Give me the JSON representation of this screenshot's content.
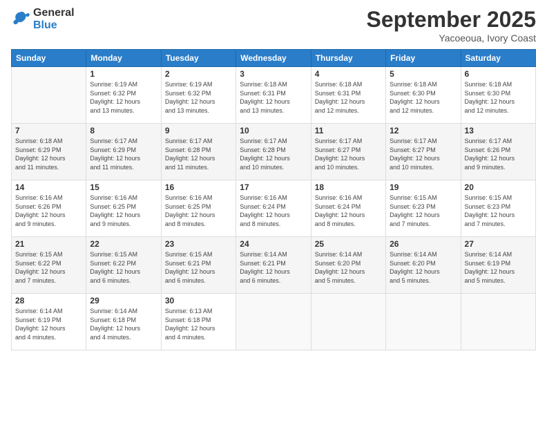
{
  "header": {
    "logo_general": "General",
    "logo_blue": "Blue",
    "month_title": "September 2025",
    "subtitle": "Yacoeoua, Ivory Coast"
  },
  "days_of_week": [
    "Sunday",
    "Monday",
    "Tuesday",
    "Wednesday",
    "Thursday",
    "Friday",
    "Saturday"
  ],
  "weeks": [
    [
      {
        "day": "",
        "sunrise": "",
        "sunset": "",
        "daylight": ""
      },
      {
        "day": "1",
        "sunrise": "Sunrise: 6:19 AM",
        "sunset": "Sunset: 6:32 PM",
        "daylight": "Daylight: 12 hours and 13 minutes."
      },
      {
        "day": "2",
        "sunrise": "Sunrise: 6:19 AM",
        "sunset": "Sunset: 6:32 PM",
        "daylight": "Daylight: 12 hours and 13 minutes."
      },
      {
        "day": "3",
        "sunrise": "Sunrise: 6:18 AM",
        "sunset": "Sunset: 6:31 PM",
        "daylight": "Daylight: 12 hours and 13 minutes."
      },
      {
        "day": "4",
        "sunrise": "Sunrise: 6:18 AM",
        "sunset": "Sunset: 6:31 PM",
        "daylight": "Daylight: 12 hours and 12 minutes."
      },
      {
        "day": "5",
        "sunrise": "Sunrise: 6:18 AM",
        "sunset": "Sunset: 6:30 PM",
        "daylight": "Daylight: 12 hours and 12 minutes."
      },
      {
        "day": "6",
        "sunrise": "Sunrise: 6:18 AM",
        "sunset": "Sunset: 6:30 PM",
        "daylight": "Daylight: 12 hours and 12 minutes."
      }
    ],
    [
      {
        "day": "7",
        "sunrise": "Sunrise: 6:18 AM",
        "sunset": "Sunset: 6:29 PM",
        "daylight": "Daylight: 12 hours and 11 minutes."
      },
      {
        "day": "8",
        "sunrise": "Sunrise: 6:17 AM",
        "sunset": "Sunset: 6:29 PM",
        "daylight": "Daylight: 12 hours and 11 minutes."
      },
      {
        "day": "9",
        "sunrise": "Sunrise: 6:17 AM",
        "sunset": "Sunset: 6:28 PM",
        "daylight": "Daylight: 12 hours and 11 minutes."
      },
      {
        "day": "10",
        "sunrise": "Sunrise: 6:17 AM",
        "sunset": "Sunset: 6:28 PM",
        "daylight": "Daylight: 12 hours and 10 minutes."
      },
      {
        "day": "11",
        "sunrise": "Sunrise: 6:17 AM",
        "sunset": "Sunset: 6:27 PM",
        "daylight": "Daylight: 12 hours and 10 minutes."
      },
      {
        "day": "12",
        "sunrise": "Sunrise: 6:17 AM",
        "sunset": "Sunset: 6:27 PM",
        "daylight": "Daylight: 12 hours and 10 minutes."
      },
      {
        "day": "13",
        "sunrise": "Sunrise: 6:17 AM",
        "sunset": "Sunset: 6:26 PM",
        "daylight": "Daylight: 12 hours and 9 minutes."
      }
    ],
    [
      {
        "day": "14",
        "sunrise": "Sunrise: 6:16 AM",
        "sunset": "Sunset: 6:26 PM",
        "daylight": "Daylight: 12 hours and 9 minutes."
      },
      {
        "day": "15",
        "sunrise": "Sunrise: 6:16 AM",
        "sunset": "Sunset: 6:25 PM",
        "daylight": "Daylight: 12 hours and 9 minutes."
      },
      {
        "day": "16",
        "sunrise": "Sunrise: 6:16 AM",
        "sunset": "Sunset: 6:25 PM",
        "daylight": "Daylight: 12 hours and 8 minutes."
      },
      {
        "day": "17",
        "sunrise": "Sunrise: 6:16 AM",
        "sunset": "Sunset: 6:24 PM",
        "daylight": "Daylight: 12 hours and 8 minutes."
      },
      {
        "day": "18",
        "sunrise": "Sunrise: 6:16 AM",
        "sunset": "Sunset: 6:24 PM",
        "daylight": "Daylight: 12 hours and 8 minutes."
      },
      {
        "day": "19",
        "sunrise": "Sunrise: 6:15 AM",
        "sunset": "Sunset: 6:23 PM",
        "daylight": "Daylight: 12 hours and 7 minutes."
      },
      {
        "day": "20",
        "sunrise": "Sunrise: 6:15 AM",
        "sunset": "Sunset: 6:23 PM",
        "daylight": "Daylight: 12 hours and 7 minutes."
      }
    ],
    [
      {
        "day": "21",
        "sunrise": "Sunrise: 6:15 AM",
        "sunset": "Sunset: 6:22 PM",
        "daylight": "Daylight: 12 hours and 7 minutes."
      },
      {
        "day": "22",
        "sunrise": "Sunrise: 6:15 AM",
        "sunset": "Sunset: 6:22 PM",
        "daylight": "Daylight: 12 hours and 6 minutes."
      },
      {
        "day": "23",
        "sunrise": "Sunrise: 6:15 AM",
        "sunset": "Sunset: 6:21 PM",
        "daylight": "Daylight: 12 hours and 6 minutes."
      },
      {
        "day": "24",
        "sunrise": "Sunrise: 6:14 AM",
        "sunset": "Sunset: 6:21 PM",
        "daylight": "Daylight: 12 hours and 6 minutes."
      },
      {
        "day": "25",
        "sunrise": "Sunrise: 6:14 AM",
        "sunset": "Sunset: 6:20 PM",
        "daylight": "Daylight: 12 hours and 5 minutes."
      },
      {
        "day": "26",
        "sunrise": "Sunrise: 6:14 AM",
        "sunset": "Sunset: 6:20 PM",
        "daylight": "Daylight: 12 hours and 5 minutes."
      },
      {
        "day": "27",
        "sunrise": "Sunrise: 6:14 AM",
        "sunset": "Sunset: 6:19 PM",
        "daylight": "Daylight: 12 hours and 5 minutes."
      }
    ],
    [
      {
        "day": "28",
        "sunrise": "Sunrise: 6:14 AM",
        "sunset": "Sunset: 6:19 PM",
        "daylight": "Daylight: 12 hours and 4 minutes."
      },
      {
        "day": "29",
        "sunrise": "Sunrise: 6:14 AM",
        "sunset": "Sunset: 6:18 PM",
        "daylight": "Daylight: 12 hours and 4 minutes."
      },
      {
        "day": "30",
        "sunrise": "Sunrise: 6:13 AM",
        "sunset": "Sunset: 6:18 PM",
        "daylight": "Daylight: 12 hours and 4 minutes."
      },
      {
        "day": "",
        "sunrise": "",
        "sunset": "",
        "daylight": ""
      },
      {
        "day": "",
        "sunrise": "",
        "sunset": "",
        "daylight": ""
      },
      {
        "day": "",
        "sunrise": "",
        "sunset": "",
        "daylight": ""
      },
      {
        "day": "",
        "sunrise": "",
        "sunset": "",
        "daylight": ""
      }
    ]
  ]
}
